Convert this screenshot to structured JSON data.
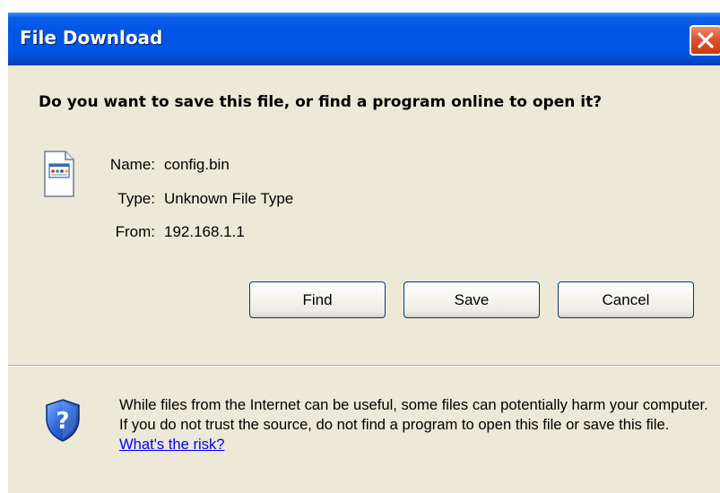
{
  "window": {
    "title": "File Download",
    "close_label": "×"
  },
  "prompt": {
    "question": "Do you want to save this file, or find a program online to open it?"
  },
  "file_info": {
    "name_label": "Name:",
    "name_value": "config.bin",
    "type_label": "Type:",
    "type_value": "Unknown File Type",
    "from_label": "From:",
    "from_value": "192.168.1.1",
    "icon": "file-icon"
  },
  "buttons": {
    "find": "Find",
    "save": "Save",
    "cancel": "Cancel"
  },
  "warning": {
    "icon": "shield-question-icon",
    "text": "While files from the Internet can be useful, some files can potentially harm your computer. If you do not trust the source, do not find a program to open this file or save this file.",
    "link_text": "What's the risk?"
  },
  "colors": {
    "titlebar": "#0055e5",
    "close_button": "#d9552f",
    "dialog_background": "#ece9d8",
    "link": "#0000ff"
  }
}
